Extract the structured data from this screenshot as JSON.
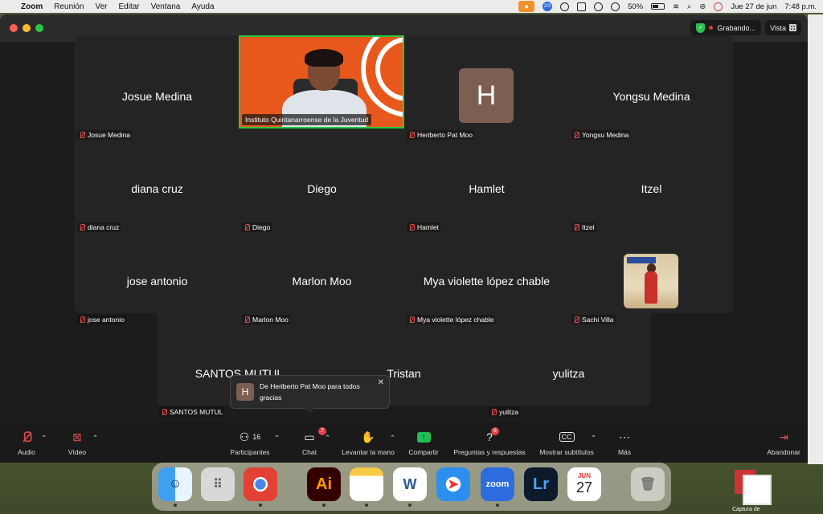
{
  "menubar": {
    "app": "Zoom",
    "items": [
      "Reunión",
      "Ver",
      "Editar",
      "Ventana",
      "Ayuda"
    ],
    "battery": "50%",
    "date": "Jue 27 de jun",
    "time": "7:48 p.m.",
    "badge": "2/3"
  },
  "window": {
    "recording": "Grabando...",
    "view": "Vista"
  },
  "tiles": [
    {
      "big": "Josue Medina",
      "label": "Josue Medina"
    },
    {
      "big": "",
      "label": "Instituto Quintanarroense de la Juventud"
    },
    {
      "big": "",
      "label": "Heriberto Pat Moo",
      "avatar": "H"
    },
    {
      "big": "Yongsu Medina",
      "label": "Yongsu Medina"
    },
    {
      "big": "diana cruz",
      "label": "diana cruz"
    },
    {
      "big": "Diego",
      "label": "Diego"
    },
    {
      "big": "Hamlet",
      "label": "Hamlet"
    },
    {
      "big": "Itzel",
      "label": "Itzel"
    },
    {
      "big": "jose antonio",
      "label": "jose antonio"
    },
    {
      "big": "Marlon Moo",
      "label": "Marlon Moo"
    },
    {
      "big": "Mya violette lópez chable",
      "label": "Mya violette lópez chable"
    },
    {
      "big": "",
      "label": "Sachi Villa"
    },
    {
      "big": "SANTOS MUTUL",
      "label": "SANTOS MUTUL"
    },
    {
      "big": "Tristan",
      "label": "Tristan"
    },
    {
      "big": "yulitza",
      "label": "yulitza"
    }
  ],
  "chat_toast": {
    "avatar": "H",
    "message": "De Heriberto Pat Moo para todos gracias"
  },
  "toolbar": {
    "audio": "Audio",
    "video": "Vídeo",
    "participants": "Participantes",
    "participants_count": "16",
    "chat": "Chat",
    "chat_badge": "7",
    "raise_hand": "Levantar la mano",
    "share": "Compartir",
    "qa": "Preguntas y respuestas",
    "qa_badge": "6",
    "captions": "Mostrar subtítulos",
    "more": "Más",
    "leave": "Abandonar"
  },
  "dock": {
    "calendar_month": "JUN",
    "calendar_day": "27",
    "zoom_label": "zoom",
    "ai": "Ai",
    "lr": "Lr",
    "word": "W",
    "file_label": "Captura de"
  }
}
